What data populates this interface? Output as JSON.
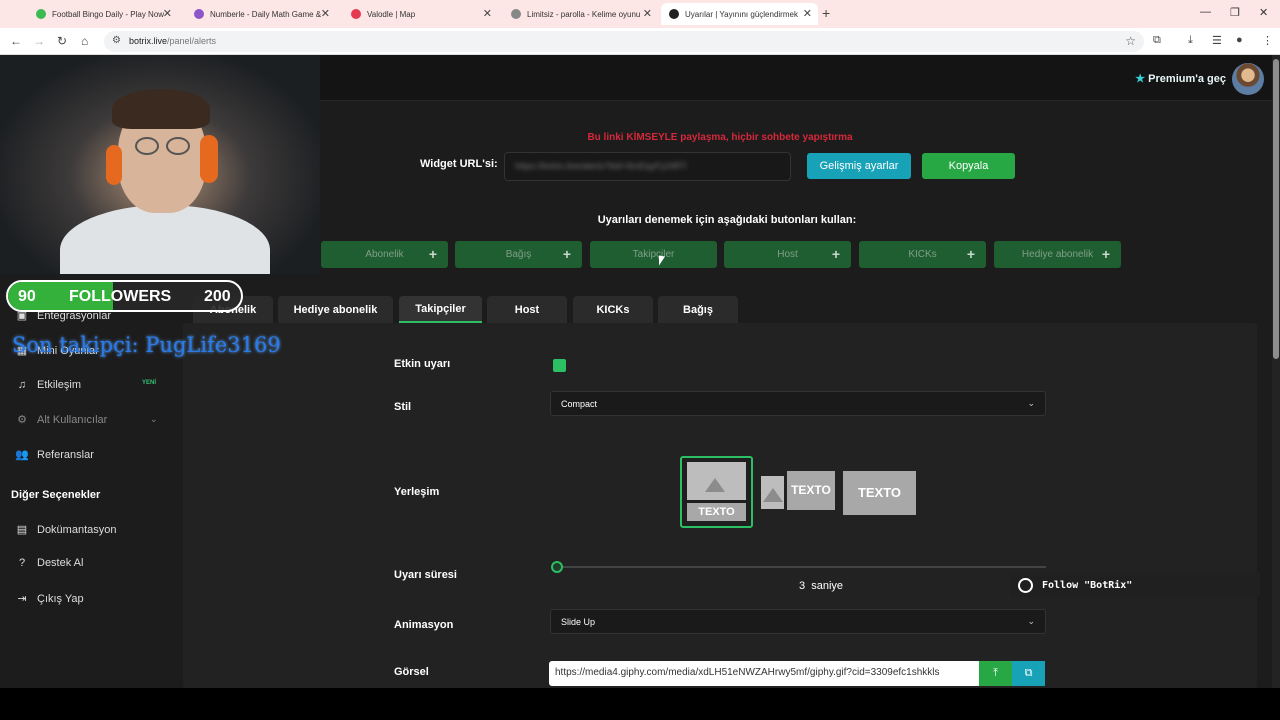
{
  "browser": {
    "tabs": [
      {
        "label": "Football Bingo Daily - Play Now",
        "color": "#3cba54"
      },
      {
        "label": "Numberle - Daily Math Game &",
        "color": "#8a56c9"
      },
      {
        "label": "Valodle | Map",
        "color": "#e53950"
      },
      {
        "label": "Limitsiz - parolla - Kelime oyunu",
        "color": "#888888"
      },
      {
        "label": "Uyarılar | Yayınını güçlendirmek",
        "color": "#222222"
      }
    ],
    "url_host": "botrix.live",
    "url_path": "/panel/alerts"
  },
  "header": {
    "premium_label": "Premium'a geç"
  },
  "widget": {
    "warning": "Bu linki KİMSEYLE paylaşma, hiçbir sohbete yapıştırma",
    "url_label": "Widget URL'si:",
    "url_value": "https://botrix.live/alerts?bid=9mEqyFy24fl7l",
    "advanced_button": "Gelişmiş ayarlar",
    "copy_button": "Kopyala"
  },
  "test": {
    "heading": "Uyarıları denemek için aşağıdaki butonları kullan:",
    "buttons": [
      "Abonelik",
      "Bağış",
      "Takipçiler",
      "Host",
      "KICKs",
      "Hediye abonelik"
    ]
  },
  "sidebar": {
    "items": [
      {
        "label": "Entegrasyonlar",
        "icon": "plug-icon"
      },
      {
        "label": "Mini Oyunlar",
        "icon": "gamepad-icon"
      },
      {
        "label": "Etkileşim",
        "icon": "music-icon",
        "badge": "YENİ"
      },
      {
        "label": "Alt Kullanıcılar",
        "icon": "users-cog-icon"
      },
      {
        "label": "Referanslar",
        "icon": "user-friends-icon"
      }
    ],
    "section_title": "Diğer Seçenekler",
    "other_items": [
      {
        "label": "Dokümantasyon",
        "icon": "docs-icon"
      },
      {
        "label": "Destek Al",
        "icon": "help-icon"
      },
      {
        "label": "Çıkış Yap",
        "icon": "logout-icon"
      }
    ]
  },
  "alert_tabs": [
    "Abonelik",
    "Hediye abonelik",
    "Takipçiler",
    "Host",
    "KICKs",
    "Bağış"
  ],
  "form": {
    "enabled_label": "Etkin uyarı",
    "style_label": "Stil",
    "style_value": "Compact",
    "layout_label": "Yerleşim",
    "layout_text": "TEXTO",
    "duration_label": "Uyarı süresi",
    "duration_value": "3",
    "duration_unit": "saniye",
    "duration_fraction": 0.0,
    "animation_label": "Animasyon",
    "animation_value": "Slide Up",
    "image_label": "Görsel",
    "image_value": "https://media4.giphy.com/media/xdLH51eNWZAHrwy5mf/giphy.gif?cid=3309efc1shkkls"
  },
  "overlay": {
    "followers_current": "90",
    "followers_label": "FOLLOWERS",
    "followers_goal": "200",
    "followers_fraction": 0.45,
    "last_follower": "Son takipçi: PugLife3169",
    "bot_message": "Follow \"BotRix\""
  },
  "colors": {
    "accent_green": "#28a745",
    "accent_teal": "#17a2b8",
    "warning_red": "#d6283b"
  }
}
